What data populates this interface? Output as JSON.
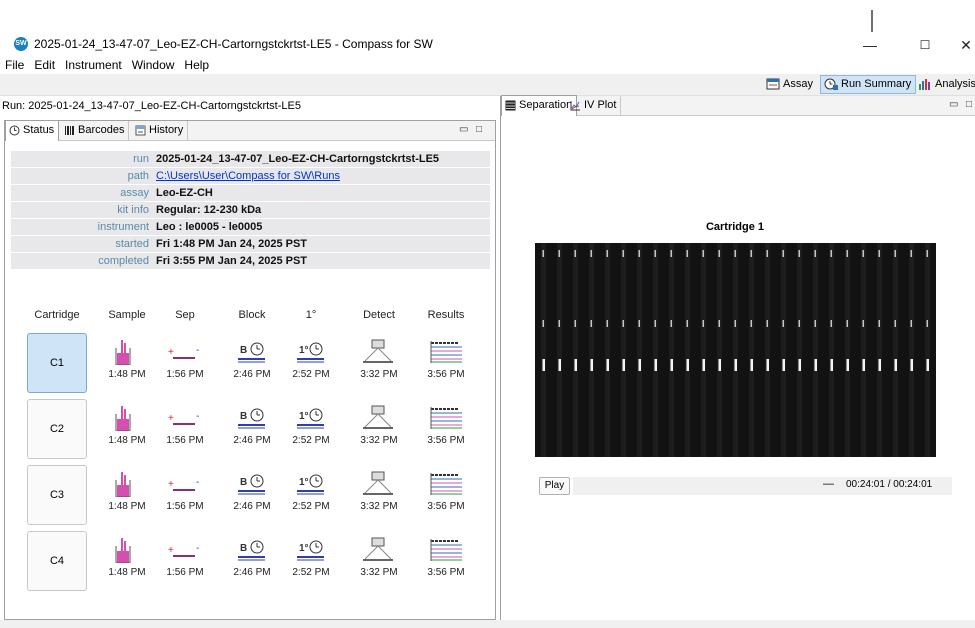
{
  "window": {
    "title": "2025-01-24_13-47-07_Leo-EZ-CH-Cartorngstckrtst-LE5 - Compass for SW",
    "app_icon_text": "SW",
    "controls": {
      "minimize": "—",
      "maximize": "☐",
      "close": "✕"
    }
  },
  "menu": [
    "File",
    "Edit",
    "Instrument",
    "Window",
    "Help"
  ],
  "perspectives": [
    {
      "label": "Assay",
      "icon": "assay-icon",
      "active": false
    },
    {
      "label": "Run Summary",
      "icon": "clock-icon",
      "active": true
    },
    {
      "label": "Analysis",
      "icon": "analysis-icon",
      "active": false
    }
  ],
  "run_bar": "Run: 2025-01-24_13-47-07_Leo-EZ-CH-Cartorngstckrtst-LE5",
  "left_tabs": [
    {
      "label": "Status",
      "icon": "clock-icon",
      "active": true
    },
    {
      "label": "Barcodes",
      "icon": "barcode-icon",
      "active": false
    },
    {
      "label": "History",
      "icon": "history-icon",
      "active": false
    }
  ],
  "info": [
    {
      "key": "run",
      "value": "2025-01-24_13-47-07_Leo-EZ-CH-Cartorngstckrtst-LE5",
      "link": false
    },
    {
      "key": "path",
      "value": "C:\\Users\\User\\Compass for SW\\Runs",
      "link": true
    },
    {
      "key": "assay",
      "value": "Leo-EZ-CH",
      "link": false
    },
    {
      "key": "kit info",
      "value": "Regular: 12-230 kDa",
      "link": false
    },
    {
      "key": "instrument",
      "value": "Leo : le0005 - le0005",
      "link": false
    },
    {
      "key": "started",
      "value": "Fri 1:48 PM Jan 24, 2025 PST",
      "link": false
    },
    {
      "key": "completed",
      "value": "Fri 3:55 PM Jan 24, 2025 PST",
      "link": false
    }
  ],
  "columns": [
    "Cartridge",
    "Sample",
    "Sep",
    "Block",
    "1°",
    "Detect",
    "Results"
  ],
  "cartridges": [
    {
      "label": "C1",
      "active": true,
      "times": [
        "1:48 PM",
        "1:56 PM",
        "2:46 PM",
        "2:52 PM",
        "3:32 PM",
        "3:56 PM"
      ]
    },
    {
      "label": "C2",
      "active": false,
      "times": [
        "1:48 PM",
        "1:56 PM",
        "2:46 PM",
        "2:52 PM",
        "3:32 PM",
        "3:56 PM"
      ]
    },
    {
      "label": "C3",
      "active": false,
      "times": [
        "1:48 PM",
        "1:56 PM",
        "2:46 PM",
        "2:52 PM",
        "3:32 PM",
        "3:56 PM"
      ]
    },
    {
      "label": "C4",
      "active": false,
      "times": [
        "1:48 PM",
        "1:56 PM",
        "2:46 PM",
        "2:52 PM",
        "3:32 PM",
        "3:56 PM"
      ]
    }
  ],
  "step_labels": {
    "block": "B",
    "primary": "1°"
  },
  "right_tabs": [
    {
      "label": "Separation",
      "icon": "separation-icon",
      "active": true
    },
    {
      "label": "IV Plot",
      "icon": "iv-plot-icon",
      "active": false
    }
  ],
  "cartridge_title": "Cartridge 1",
  "player": {
    "play_label": "Play",
    "dash": "—",
    "time": "00:24:01 / 00:24:01"
  },
  "gel": {
    "lanes": 25,
    "band_rows": 3
  }
}
